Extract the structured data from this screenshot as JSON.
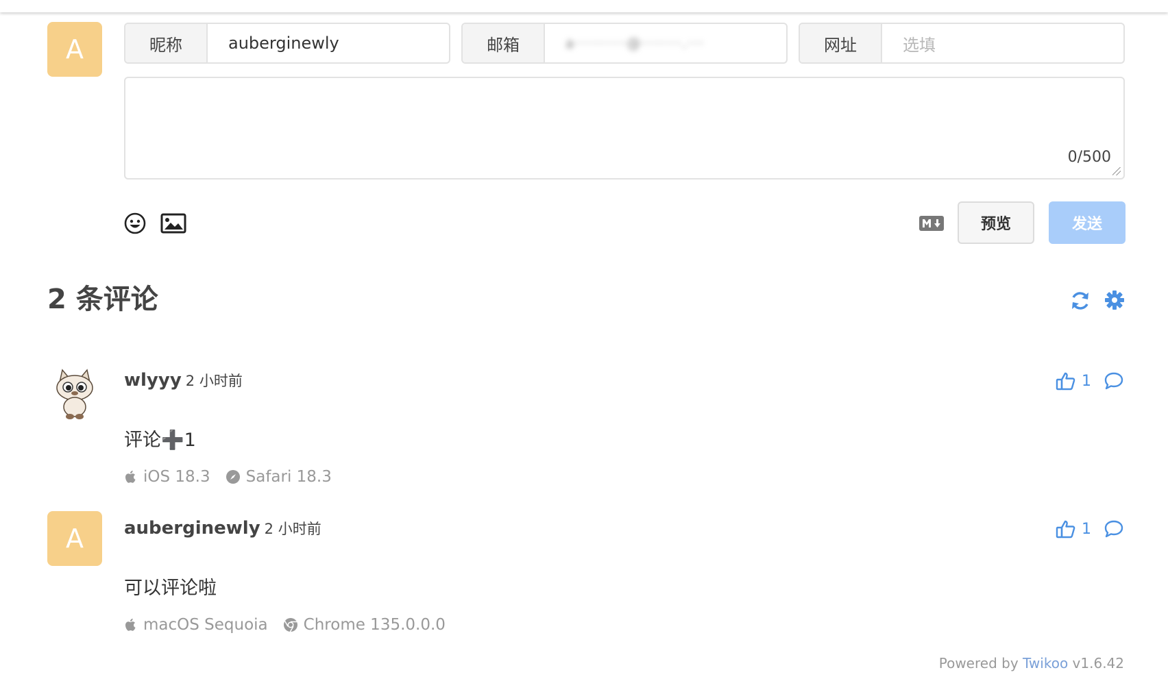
{
  "form": {
    "avatar_letter": "A",
    "nickname_label": "昵称",
    "nickname_value": "auberginewly",
    "email_label": "邮箱",
    "email_value": "a·········@·······.···",
    "url_label": "网址",
    "url_placeholder": "选填",
    "char_count": "0/500",
    "preview_button": "预览",
    "send_button": "发送"
  },
  "comments_header": {
    "title": "2 条评论"
  },
  "comments": [
    {
      "author": "wlyyy",
      "time": "2 小时前",
      "body": "评论➕1",
      "likes": "1",
      "os": "iOS 18.3",
      "browser": "Safari 18.3"
    },
    {
      "author": "auberginewly",
      "avatar_letter": "A",
      "time": "2 小时前",
      "body": "可以评论啦",
      "likes": "1",
      "os": "macOS Sequoia",
      "browser": "Chrome 135.0.0.0"
    }
  ],
  "footer": {
    "powered_prefix": "Powered by",
    "powered_link": "Twikoo",
    "version": "v1.6.42"
  },
  "colors": {
    "accent": "#4a90e2",
    "avatar_bg": "#f7d08a",
    "send_disabled": "#a9cdfa"
  }
}
